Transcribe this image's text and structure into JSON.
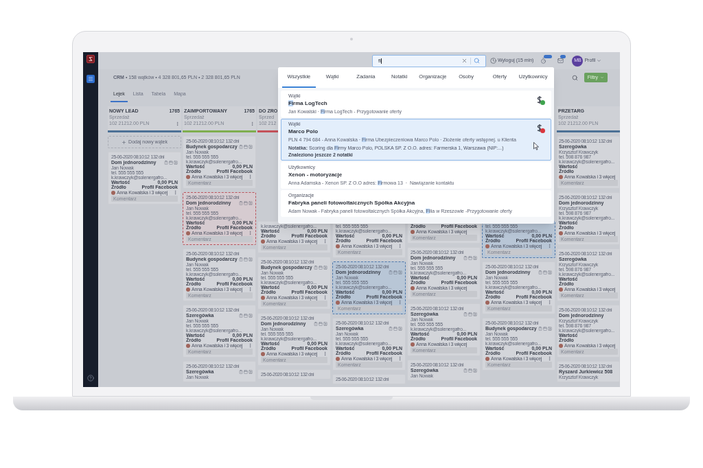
{
  "topbar": {
    "search": {
      "value": "fi"
    },
    "logout": "Wyloguj (15 min)",
    "profile": {
      "initials": "MB",
      "label": "Profil"
    }
  },
  "breadcrumb": "**CRM** • 158 wątków • 4 328 801,65 PLN • 2 328 801,65 PLN",
  "filter_button": "Filtry",
  "tabs": [
    {
      "label": "Lejek",
      "selected": true
    },
    {
      "label": "Lista",
      "selected": false
    },
    {
      "label": "Tabela",
      "selected": false
    },
    {
      "label": "Mapa",
      "selected": false
    }
  ],
  "columns": [
    {
      "title": "NOWY LEAD",
      "count": "1765",
      "subtitle": "Sprzedaż",
      "amount": "102 21212.00 PLN",
      "menu": true,
      "color": "#4d7196",
      "add_button": "Dodaj nowy wątek",
      "cards": [
        {
          "kind": "normal",
          "date": "25-06-2020 08:10:12",
          "age": "132 dni",
          "title": "Dom jednorodzinny",
          "contact": "Jan Nowak",
          "phone": "tel. 555 555 555",
          "email": "k.krawczyk@solenergafro...",
          "value_label": "Wartość",
          "value": "0,00 PLN",
          "source_label": "Źródło",
          "source": "Profil Facebook",
          "assignee": "Anna Kowalska i 3 więcej",
          "menu": true,
          "comment": "Komentarz"
        }
      ]
    },
    {
      "title": "ZAIMPORTOWANY",
      "count": "1765",
      "subtitle": "Sprzedaż",
      "amount": "102 21212.00 PLN",
      "menu": true,
      "color": "#7fae4f",
      "cards": [
        {
          "kind": "normal",
          "date": "25-06-2020 08:10:12",
          "age": "132 dni",
          "title": "Budynek gospodarczy",
          "contact": "Jan Nowak",
          "phone": "tel. 555 555 555",
          "email": "k.krawczyk@solenergafro...",
          "value_label": "Wartość",
          "value": "0,00 PLN",
          "source_label": "Źródło",
          "source": "Profil Facebook",
          "assignee": "Anna Kowalska i 3 więcej",
          "menu": true,
          "comment": "Komentarz"
        },
        {
          "kind": "flagged",
          "date": "25-06-2020 08:10:12",
          "age": "132 dni",
          "title": "Dom jednorodzinny",
          "contact": "Jan Nowak",
          "phone": "tel. 555 555 555",
          "email": "k.krawczyk@solenergafro...",
          "value_label": "Wartość",
          "value": "0,00 PLN",
          "source_label": "Źródło",
          "source": "Profil Facebook",
          "assignee": "Anna Kowalska i 3 więcej",
          "menu": true,
          "comment": "Komentarz"
        },
        {
          "kind": "normal",
          "date": "25-06-2020 08:10:12",
          "age": "132 dni",
          "title": "Budynek gospodarczy",
          "contact": "Jan Nowak",
          "phone": "tel. 555 555 555",
          "email": "k.krawczyk@solenergafro...",
          "value_label": "Wartość",
          "value": "0,00 PLN",
          "source_label": "Źródło",
          "source": "Profil Facebook",
          "assignee": "Anna Kowalska i 3 więcej",
          "menu": true,
          "comment": "Komentarz"
        },
        {
          "kind": "normal",
          "date": "25-06-2020 08:10:12",
          "age": "132 dni",
          "title": "Szeregówka",
          "contact": "Jan Nowak",
          "phone": "tel. 555 555 555",
          "email": "k.krawczyk@solenergafro...",
          "value_label": "Wartość",
          "value": "0,00 PLN",
          "source_label": "Źródło",
          "source": "Profil Facebook",
          "assignee": "Anna Kowalska i 3 więcej",
          "menu": true,
          "comment": "Komentarz"
        },
        {
          "kind": "normal",
          "date": "25-06-2020 08:10:12",
          "age": "132 dni",
          "title": "Szeregówka",
          "contact": "Jan Nowak"
        }
      ]
    },
    {
      "title": "DO ZRO",
      "subtitle": "Sprzed",
      "amount": "102 212",
      "menu": false,
      "color": "#c4525a",
      "cards": [
        {
          "kind": "normal",
          "email": "k.krawczyk@solenergafro...",
          "value_label": "Wartość",
          "value": "0,00 PLN",
          "source_label": "Źródło",
          "source": "Profil Facebook",
          "assignee": "Anna Kowalska i 3 więcej",
          "menu": true,
          "comment": "Komentarz"
        },
        {
          "kind": "normal",
          "date": "25-06-2020 08:10:12",
          "age": "132 dni",
          "title": "Budynek gospodarczy",
          "contact": "Jan Nowak",
          "phone": "tel. 555 555 555",
          "email": "k.krawczyk@solenergafro...",
          "value_label": "Wartość",
          "value": "0,00 PLN",
          "source_label": "Źródło",
          "source": "Profil Facebook",
          "assignee": "Anna Kowalska i 3 więcej",
          "menu": true,
          "comment": "Komentarz"
        },
        {
          "kind": "normal",
          "date": "25-06-2020 08:10:12",
          "age": "132 dni",
          "title": "Dom jednorodzinny",
          "contact": "Jan Nowak",
          "phone": "tel. 555 555 555",
          "email": "k.krawczyk@solenergafro...",
          "value_label": "Wartość",
          "value": "0,00 PLN",
          "source_label": "Źródło",
          "source": "Profil Facebook",
          "assignee": "Anna Kowalska i 3 więcej",
          "menu": true,
          "comment": "Komentarz"
        },
        {
          "kind": "normal",
          "date": "25-06-2020 08:10:12",
          "age": "132 dni"
        }
      ]
    },
    {
      "cards": [
        {
          "kind": "normal",
          "phone": "tel. 555 555 555",
          "email": "k.krawczyk@solenergafro...",
          "value_label": "Wartość",
          "value": "0,00 PLN",
          "source_label": "Źródło",
          "source": "Profil Facebook",
          "assignee": "Anna Kowalska i 3 więcej",
          "menu": true,
          "comment": "Komentarz"
        },
        {
          "kind": "marked",
          "date": "25-06-2020 08:10:12",
          "age": "132 dni",
          "title": "Dom jednorodzinny",
          "contact": "Jan Nowak",
          "phone": "tel. 555 555 555",
          "email": "k.krawczyk@solenergafro...",
          "value_label": "Wartość",
          "value": "0,00 PLN",
          "source_label": "Źródło",
          "source": "Profil Facebook",
          "assignee": "Anna Kowalska i 3 więcej",
          "menu": true,
          "comment": "Komentarz"
        },
        {
          "kind": "normal",
          "date": "25-06-2020 08:10:12",
          "age": "132 dni",
          "title": "Szeregówka",
          "contact": "Jan Nowak",
          "phone": "tel. 555 555 555",
          "email": "k.krawczyk@solenergafro...",
          "value_label": "Wartość",
          "value": "0,00 PLN",
          "source_label": "Źródło",
          "source": "Profil Facebook",
          "assignee": "Anna Kowalska i 3 więcej",
          "menu": true,
          "comment": "Komentarz"
        },
        {
          "kind": "normal",
          "date": "25-06-2020 08:10:12",
          "age": "132 dni"
        }
      ]
    },
    {
      "cards": [
        {
          "kind": "normal",
          "source_label": "Źródło",
          "source": "Profil Facebook",
          "assignee": "Anna Kowalska i 3 więcej",
          "menu": false,
          "comment": "Komentarz"
        },
        {
          "kind": "normal",
          "date": "25-06-2020 08:10:12",
          "age": "132 dni",
          "title": "Dom jednorodzinny",
          "contact": "Jan Nowak",
          "phone": "tel. 555 555 555",
          "email": "k.krawczyk@solenergafro...",
          "value_label": "Wartość",
          "value": "0,00 PLN",
          "source_label": "Źródło",
          "source": "Profil Facebook",
          "assignee": "Anna Kowalska i 3 więcej",
          "menu": false,
          "comment": "Komentarz"
        },
        {
          "kind": "normal",
          "date": "25-06-2020 08:10:12",
          "age": "132 dni",
          "title": "Szeregówka",
          "contact": "Jan Nowak",
          "phone": "tel. 555 555 555",
          "email": "k.krawczyk@solenergafro...",
          "value_label": "Wartość",
          "value": "0,00 PLN",
          "source_label": "Źródło",
          "source": "Profil Facebook",
          "assignee": "Anna Kowalska i 3 więcej",
          "menu": false,
          "comment": "Komentarz"
        },
        {
          "kind": "normal",
          "date": "25-06-2020 08:10:12",
          "age": "132 dni",
          "title": "Szeregówka",
          "contact": "Jan Nowak"
        }
      ]
    },
    {
      "cards": [
        {
          "kind": "marked",
          "phone": "tel. 555 555 555",
          "email": "k.krawczyk@solenergafro...",
          "value_label": "Wartość",
          "value": "0,00 PLN",
          "source_label": "Źródło",
          "source": "Profil Facebook",
          "assignee": "Anna Kowalska i 3 więcej",
          "menu": true,
          "comment": "Komentarz"
        },
        {
          "kind": "normal",
          "date": "25-06-2020 08:10:12",
          "age": "132 dni",
          "title": "Dom jednorodzinny",
          "contact": "Jan Nowak",
          "phone": "tel. 555 555 555",
          "email": "k.krawczyk@solenergafro...",
          "value_label": "Wartość",
          "value": "0,00 PLN",
          "source_label": "Źródło",
          "source": "Profil Facebook",
          "assignee": "Anna Kowalska i 3 więcej",
          "menu": true,
          "comment": "Komentarz"
        },
        {
          "kind": "normal",
          "date": "25-06-2020 08:10:12",
          "age": "132 dni",
          "title": "Budynek gospodarczy",
          "contact": "Jan Nowak",
          "phone": "tel. 555 555 555",
          "email": "k.krawczyk@solenergafro...",
          "value_label": "Wartość",
          "value": "0,00 PLN",
          "source_label": "Źródło",
          "source": "Profil Facebook",
          "assignee": "Anna Kowalska i 3 więcej",
          "menu": true,
          "comment": "Komentarz"
        }
      ]
    },
    {
      "title": "PRZETARG",
      "subtitle": "Sprzedaż",
      "amount": "102 21212.00 PLN",
      "menu": false,
      "color": "#4d7196",
      "cards": [
        {
          "kind": "normal",
          "date": "25-06-2020 08:10:12",
          "age": "132 dni",
          "title": "Szeregówka",
          "contact": "Krzysztof Krawczyk",
          "phone": "tel. 598 876 987",
          "email": "k.krawczyk@solenergafro...",
          "value_label": "Wartość",
          "source_label": "Źródło",
          "assignee": "Anna Kowalska i 3 więcej",
          "menu": false,
          "comment": "Komentarz"
        },
        {
          "kind": "normal",
          "date": "25-06-2020 08:10:12",
          "age": "132 dni",
          "title": "Dom jednorodzinny",
          "contact": "Krzysztof Krawczyk",
          "phone": "tel. 598 876 987",
          "email": "k.krawczyk@solenergafro...",
          "value_label": "Wartość",
          "source_label": "Źródło",
          "assignee": "Anna Kowalska i 3 więcej",
          "menu": false,
          "comment": "Komentarz"
        },
        {
          "kind": "normal",
          "date": "25-06-2020 08:10:12",
          "age": "132 dni",
          "title": "Szeregówka",
          "contact": "Krzysztof Krawczyk",
          "phone": "tel. 598 876 987",
          "email": "k.krawczyk@solenergafro...",
          "value_label": "Wartość",
          "source_label": "Źródło",
          "assignee": "Anna Kowalska i 3 więcej",
          "menu": false,
          "comment": "Komentarz"
        },
        {
          "kind": "normal",
          "date": "25-06-2020 08:10:12",
          "age": "132 dni",
          "title": "Dom jednorodzinny",
          "contact": "Krzysztof Krawczyk",
          "phone": "tel. 598 876 987",
          "email": "k.krawczyk@solenergafro...",
          "value_label": "Wartość",
          "source_label": "Źródło",
          "assignee": "Anna Kowalska i 3 więcej",
          "menu": false,
          "comment": "Komentarz"
        },
        {
          "kind": "normal",
          "date": "25-06-2020 08:10:12",
          "age": "132 dni",
          "title": "Ryszard Jurkiewicz 508",
          "contact": "Krzysztof Krawczyk"
        }
      ]
    }
  ],
  "search_results": {
    "tabs": [
      {
        "label": "Wszystkie",
        "selected": true
      },
      {
        "label": "Wątki",
        "selected": false
      },
      {
        "label": "Zadania",
        "selected": false
      },
      {
        "label": "Notatki",
        "selected": false
      },
      {
        "label": "Organizacje",
        "selected": false
      },
      {
        "label": "Osoby",
        "selected": false
      },
      {
        "label": "Oferty",
        "selected": false
      },
      {
        "label": "Użytkownicy",
        "selected": false
      }
    ],
    "results": [
      {
        "category": "Wątki",
        "title": [
          {
            "text": "Fi",
            "match": true
          },
          {
            "text": "rma LogTech",
            "match": false
          }
        ],
        "details": [
          {
            "text": "Jan Kowalski · ",
            "match": false
          },
          {
            "text": "Fi",
            "match": true
          },
          {
            "text": "rma LogTech - Przygotowanie oferty",
            "match": false
          }
        ],
        "color": "#3fa34d",
        "selected": false
      },
      {
        "category": "Wątki",
        "title": [
          {
            "text": "Marco Polo",
            "match": false
          }
        ],
        "details": [
          {
            "text": "PLN 4 794 684 - Anna Kowalska · ",
            "match": false
          },
          {
            "text": "Fi",
            "match": true
          },
          {
            "text": "rma Ubezpieczeniowa Marco Polo · Złożenie oferty wstępnej. u Klienta",
            "match": false
          }
        ],
        "note_label": "Notatka:",
        "note": [
          {
            "text": " Scoring dla ",
            "match": false
          },
          {
            "text": "Fi",
            "match": true
          },
          {
            "text": "rmy Marco Polo, POLSKA SP. Z O.O. adres: Farmerska 1, Warszawa (NIP:...)",
            "match": false
          }
        ],
        "more": "Znaleziono jeszcze 2 notatki",
        "color": "#d9363e",
        "selected": true
      },
      {
        "category": "Użytkownicy",
        "title": [
          {
            "text": "Xenon - motoryzacje",
            "match": false
          }
        ],
        "details": [
          {
            "text": "Anna Adamska - Xenon SP. Z O.O adres: ",
            "match": false
          },
          {
            "text": "Fi",
            "match": true
          },
          {
            "text": "rmowa 13  ·  Nawiązanie kontaktu",
            "match": false
          }
        ],
        "selected": false
      },
      {
        "category": "Organizacje",
        "title": [
          {
            "text": "Fabryka paneli fotowoltaicznych Spółka Akcyjna",
            "match": false
          }
        ],
        "details": [
          {
            "text": "Adam Nowak - Fabryka paneli fotowoltaicznych Spółka Akcyjna, ",
            "match": false
          },
          {
            "text": "Fi",
            "match": true
          },
          {
            "text": "lia w Rzeszowie -Przygotowanie oferty",
            "match": false
          }
        ],
        "selected": false
      }
    ]
  }
}
